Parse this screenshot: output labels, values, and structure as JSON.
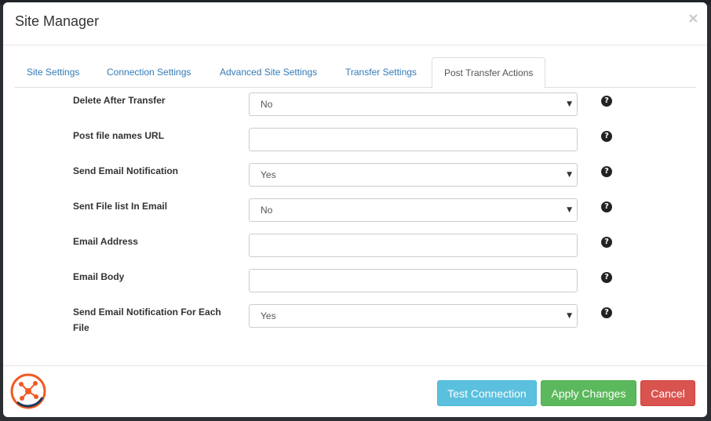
{
  "dialog": {
    "title": "Site Manager",
    "close_label": "×"
  },
  "tabs": [
    {
      "label": "Site Settings",
      "active": false
    },
    {
      "label": "Connection Settings",
      "active": false
    },
    {
      "label": "Advanced Site Settings",
      "active": false
    },
    {
      "label": "Transfer Settings",
      "active": false
    },
    {
      "label": "Post Transfer Actions",
      "active": true
    }
  ],
  "form": {
    "rows": [
      {
        "label": "Delete After Transfer",
        "type": "select",
        "value": "No"
      },
      {
        "label": "Post file names URL",
        "type": "text",
        "value": ""
      },
      {
        "label": "Send Email Notification",
        "type": "select",
        "value": "Yes"
      },
      {
        "label": "Sent File list In Email",
        "type": "select",
        "value": "No"
      },
      {
        "label": "Email Address",
        "type": "text",
        "value": ""
      },
      {
        "label": "Email Body",
        "type": "text",
        "value": ""
      },
      {
        "label": "Send Email Notification For Each File",
        "type": "select",
        "value": "Yes"
      }
    ],
    "help_icon": "question-circle-icon",
    "help_glyph": "?",
    "select_arrow_glyph": "▼"
  },
  "footer": {
    "test_label": "Test Connection",
    "apply_label": "Apply Changes",
    "cancel_label": "Cancel"
  },
  "colors": {
    "link": "#337ab7",
    "info": "#5bc0de",
    "success": "#5cb85c",
    "danger": "#d9534f",
    "logo_orange": "#f15a22",
    "logo_navy": "#1b3a5c"
  }
}
